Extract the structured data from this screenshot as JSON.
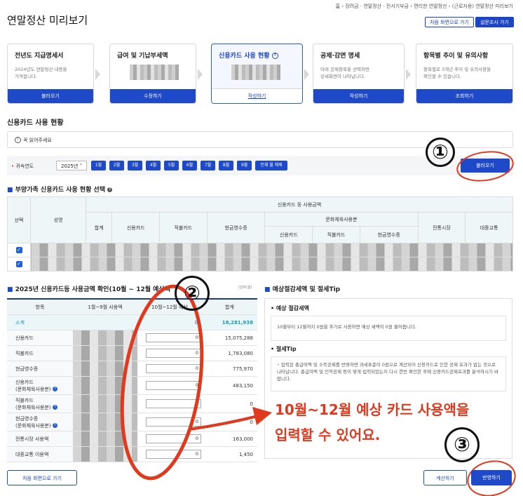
{
  "breadcrumb": "홈 › 장려금 · 연말정산 · 전서기부금 › 편리한 연말정산 › (근로자용) 연말정산 미리보기",
  "page_title": "연말정산 미리보기",
  "header_buttons": {
    "home": "처음 화면으로 가기",
    "survey": "설문조사 가기"
  },
  "steps": [
    {
      "title": "전년도 지급명세서",
      "desc1": "2024년도 연말정산 내용을",
      "desc2": "가져옵니다.",
      "action": "불러오기"
    },
    {
      "title": "급여 및 기납부세액",
      "desc1": "",
      "desc2": "",
      "action": "수정하기"
    },
    {
      "title": "신용카드 사용 현황",
      "desc1": "",
      "desc2": "",
      "action": "작성하기"
    },
    {
      "title": "공제·감면 명세",
      "desc1": "아래 공제항목을 선택하면",
      "desc2": "상세화면이 나타납니다.",
      "action": "작성하기"
    },
    {
      "title": "항목별 추이 및 유의사항",
      "desc1": "항목별로 3개년 추이 및 유의사항을",
      "desc2": "확인할 수 있습니다.",
      "action": "조회하기"
    }
  ],
  "section_title": "신용카드 사용 현황",
  "notice": "꼭 읽어주세요",
  "filter": {
    "label": "• 귀속연도",
    "year": "2025년",
    "months": [
      "1월",
      "2월",
      "3월",
      "4월",
      "5월",
      "6월",
      "7월",
      "8월",
      "9월"
    ],
    "all": "전체 월 해제",
    "load": "불러오기"
  },
  "dep_title": "부양가족 신용카드 사용 현황 선택",
  "dep_table": {
    "select": "선택",
    "name": "성명",
    "group": "신용카드 등 사용금액",
    "total": "합계",
    "credit": "신용카드",
    "debit": "직불카드",
    "cash": "현금영수증",
    "culture": "문화체육사용분",
    "market": "전통시장",
    "transit": "대중교통",
    "cul_credit": "신용카드",
    "cul_debit": "직불카드",
    "cul_cash": "현금영수증"
  },
  "confirm": {
    "title": "2025년 신용카드등 사용금액 확인(10월 ~ 12월 예상액",
    "unit": "(단위:원)",
    "h_item": "항목",
    "h_jan": "1월~9월 사용액",
    "h_oct": "10월~12월 예상",
    "h_total": "합계",
    "rows": [
      {
        "label": "소계",
        "oct": "0",
        "total": "18,281,938"
      },
      {
        "label": "신용카드",
        "oct": "0",
        "total": "15,075,288"
      },
      {
        "label": "직불카드",
        "oct": "0",
        "total": "1,783,080"
      },
      {
        "label": "현금영수증",
        "oct": "0",
        "total": "775,970"
      },
      {
        "label": "신용카드",
        "label2": "(문화체육사용분)",
        "oct": "0",
        "total": "483,150"
      },
      {
        "label": "직불카드",
        "label2": "(문화체육사용분)",
        "oct": "0",
        "total": "0"
      },
      {
        "label": "현금영수증",
        "label2": "(문화체육사용분)",
        "oct": "0",
        "total": "0"
      },
      {
        "label": "전통시장 사용액",
        "oct": "0",
        "total": "163,000"
      },
      {
        "label": "대중교통 이용액",
        "oct": "0",
        "total": "1,450"
      }
    ]
  },
  "tip": {
    "title": "예상절감세액 및 절세Tip",
    "saving_h": "예상 절감세액",
    "saving_text": "10월부터 12월까지 0원을 추가로 사용하면 예상 세액이 0원 줄어듭니다.",
    "tip_h": "절세Tip",
    "tip_text": "입력된 총급여액 및 소득공제를 반영하면 과세표준이 0원으로 계산되어 신용카드로 인한 공제 효과가 없는 것으로 나타납니다. 총급여액 및 인적공제 등이 맞게 입력되었는지 다시 한번 확인한 후에 신용카드공제효과를 분석하시기 바랍니다."
  },
  "annotation": {
    "line1": "10월~12월 예상 카드 사용액을",
    "line2": "입력할 수 있어요.",
    "n1": "①",
    "n2": "②",
    "n3": "③"
  },
  "bottom": {
    "home": "처음 화면으로 가기",
    "calc": "계산하기",
    "apply": "반영하기"
  }
}
